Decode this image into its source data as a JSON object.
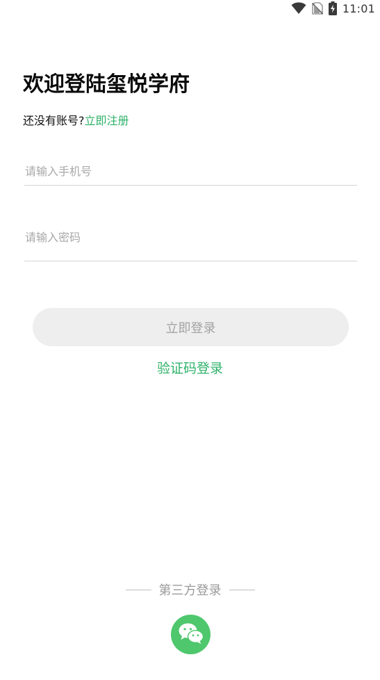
{
  "status_bar": {
    "time": "11:01",
    "icons": [
      "wifi-icon",
      "no-sim-icon",
      "battery-charging-icon"
    ]
  },
  "header": {
    "title": "欢迎登陆玺悦学府",
    "register_prompt": "还没有账号?",
    "register_link": "立即注册"
  },
  "form": {
    "phone_placeholder": "请输入手机号",
    "phone_value": "",
    "password_placeholder": "请输入密码",
    "password_value": "",
    "login_button": "立即登录",
    "code_login_link": "验证码登录"
  },
  "third_party": {
    "label": "第三方登录",
    "providers": [
      "wechat-icon"
    ]
  },
  "colors": {
    "accent": "#2fb26a",
    "wechat": "#4fc76d",
    "button_bg": "#eeeeee",
    "button_text": "#a3a3a3",
    "placeholder": "#a8a8a8"
  }
}
